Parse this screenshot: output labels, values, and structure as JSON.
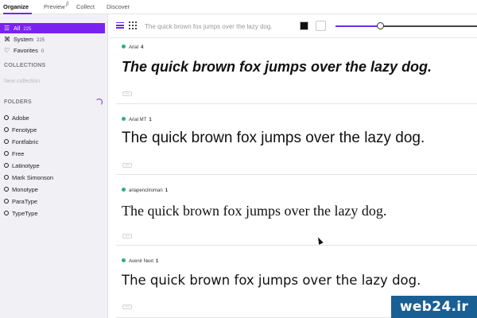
{
  "tabs": [
    {
      "label": "Organize",
      "active": true
    },
    {
      "label": "Preview",
      "active": false
    },
    {
      "label": "Collect",
      "active": false
    },
    {
      "label": "Discover",
      "active": false
    }
  ],
  "preview_beta": "β",
  "sidebar": {
    "library": [
      {
        "label": "All",
        "count": "225",
        "icon": "list-icon",
        "selected": true
      },
      {
        "label": "System",
        "count": "225",
        "icon": "command-icon",
        "selected": false
      },
      {
        "label": "Favorites",
        "count": "0",
        "icon": "heart-icon",
        "selected": false
      }
    ],
    "collections_heading": "COLLECTIONS",
    "new_collection_placeholder": "New collection",
    "folders_heading": "FOLDERS",
    "folders": [
      "Adobe",
      "Fenotype",
      "Fontfabric",
      "Free",
      "Latinotype",
      "Mark Simonson",
      "Monotype",
      "ParaType",
      "TypeType"
    ]
  },
  "toolbar": {
    "sample_text": "The quick brown fox jumps over the lazy dog.",
    "size_slider_fraction": 0.32,
    "colors": {
      "foreground": "#111111",
      "background": "#ffffff",
      "accent": "#6b2ee6"
    }
  },
  "fonts": [
    {
      "name": "Arial",
      "count": "4",
      "sample": "The quick brown fox jumps over the lazy dog.",
      "more": "..."
    },
    {
      "name": "Arial MT",
      "count": "1",
      "sample": "The quick brown fox jumps over the lazy dog.",
      "more": "..."
    },
    {
      "name": "ariapencilroman",
      "count": "1",
      "sample": "The quick brown fox jumps over the lazy dog.",
      "more": "..."
    },
    {
      "name": "Avenir Next",
      "count": "1",
      "sample": "The quick brown fox jumps over the lazy dog.",
      "more": "..."
    }
  ],
  "watermark": "web24.ir"
}
